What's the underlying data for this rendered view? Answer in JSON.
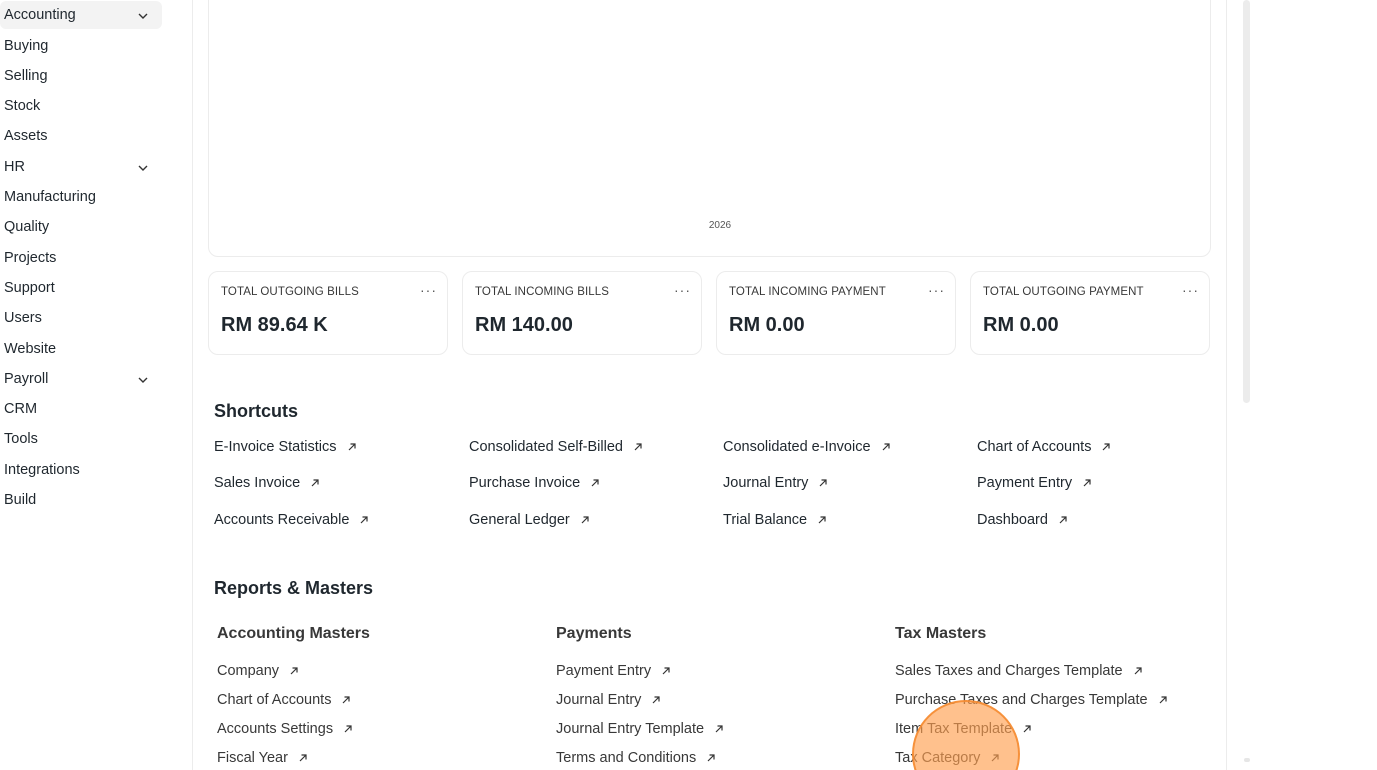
{
  "sidebar": {
    "items": [
      {
        "label": "Accounting",
        "expandable": true,
        "active": true
      },
      {
        "label": "Buying"
      },
      {
        "label": "Selling"
      },
      {
        "label": "Stock"
      },
      {
        "label": "Assets"
      },
      {
        "label": "HR",
        "expandable": true
      },
      {
        "label": "Manufacturing"
      },
      {
        "label": "Quality"
      },
      {
        "label": "Projects"
      },
      {
        "label": "Support"
      },
      {
        "label": "Users"
      },
      {
        "label": "Website"
      },
      {
        "label": "Payroll",
        "expandable": true
      },
      {
        "label": "CRM"
      },
      {
        "label": "Tools"
      },
      {
        "label": "Integrations"
      },
      {
        "label": "Build"
      }
    ]
  },
  "chart": {
    "year_label": "2026"
  },
  "stats": [
    {
      "label": "TOTAL OUTGOING BILLS",
      "value": "RM 89.64 K"
    },
    {
      "label": "TOTAL INCOMING BILLS",
      "value": "RM 140.00"
    },
    {
      "label": "TOTAL INCOMING PAYMENT",
      "value": "RM 0.00"
    },
    {
      "label": "TOTAL OUTGOING PAYMENT",
      "value": "RM 0.00"
    }
  ],
  "stat_menu": "···",
  "shortcuts": {
    "title": "Shortcuts",
    "items": [
      "E-Invoice Statistics",
      "Consolidated Self-Billed",
      "Consolidated e-Invoice",
      "Chart of Accounts",
      "Sales Invoice",
      "Purchase Invoice",
      "Journal Entry",
      "Payment Entry",
      "Accounts Receivable",
      "General Ledger",
      "Trial Balance",
      "Dashboard"
    ]
  },
  "reports": {
    "title": "Reports & Masters",
    "groups": [
      {
        "title": "Accounting Masters",
        "links": [
          "Company",
          "Chart of Accounts",
          "Accounts Settings",
          "Fiscal Year"
        ]
      },
      {
        "title": "Payments",
        "links": [
          "Payment Entry",
          "Journal Entry",
          "Journal Entry Template",
          "Terms and Conditions"
        ]
      },
      {
        "title": "Tax Masters",
        "links": [
          "Sales Taxes and Charges Template",
          "Purchase Taxes and Charges Template",
          "Item Tax Template",
          "Tax Category"
        ]
      }
    ]
  },
  "icons": {
    "chevron": "chevron-down-icon",
    "arrow": "arrow-up-right-icon",
    "menu": "more-horizontal-icon"
  },
  "colors": {
    "text": "#1f272e",
    "muted": "#383838",
    "border": "#ececec",
    "active_bg": "#f3f3f3",
    "cursor": "#f5a050"
  }
}
